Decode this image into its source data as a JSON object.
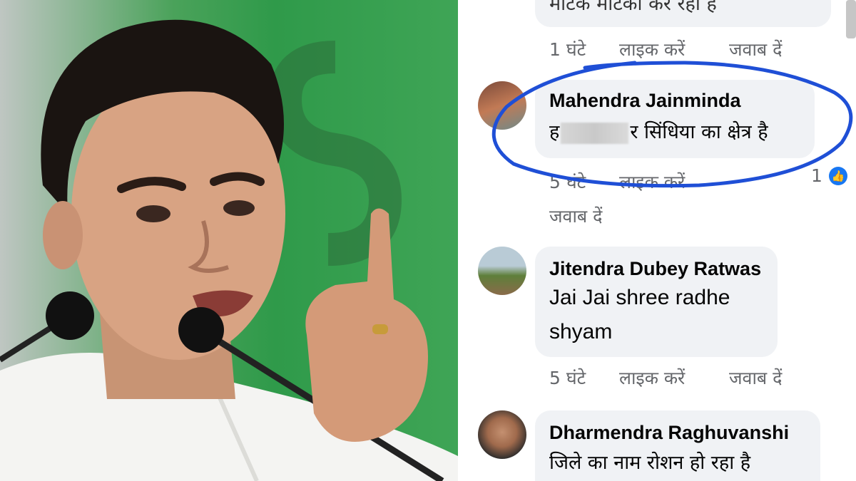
{
  "comments": [
    {
      "partial_text": "मटिके मटिका कर रहा है",
      "time": "1 घंटे",
      "like": "लाइक करें",
      "reply": "जवाब दें"
    },
    {
      "author": "Mahendra Jainminda",
      "text_prefix": "ह",
      "text_suffix": "र सिंधिया का क्षेत्र है",
      "time": "5 घंटे",
      "like": "लाइक करें",
      "reply": "जवाब दें",
      "reaction_count": "1",
      "annotation_color": "#1f4fd6"
    },
    {
      "author": "Jitendra Dubey Ratwas",
      "text_line1": "Jai Jai shree radhe",
      "text_line2": "shyam",
      "time": "5 घंटे",
      "like": "लाइक करें",
      "reply": "जवाब दें"
    },
    {
      "author": "Dharmendra Raghuvanshi",
      "text": "जिले का नाम रोशन हो रहा है"
    }
  ],
  "colors": {
    "bubble": "#f0f2f5",
    "meta": "#65676b",
    "like_badge": "#1877f2",
    "photo_background": "#2f9a4a"
  },
  "icons": {
    "reaction": "thumbs-up-icon"
  }
}
